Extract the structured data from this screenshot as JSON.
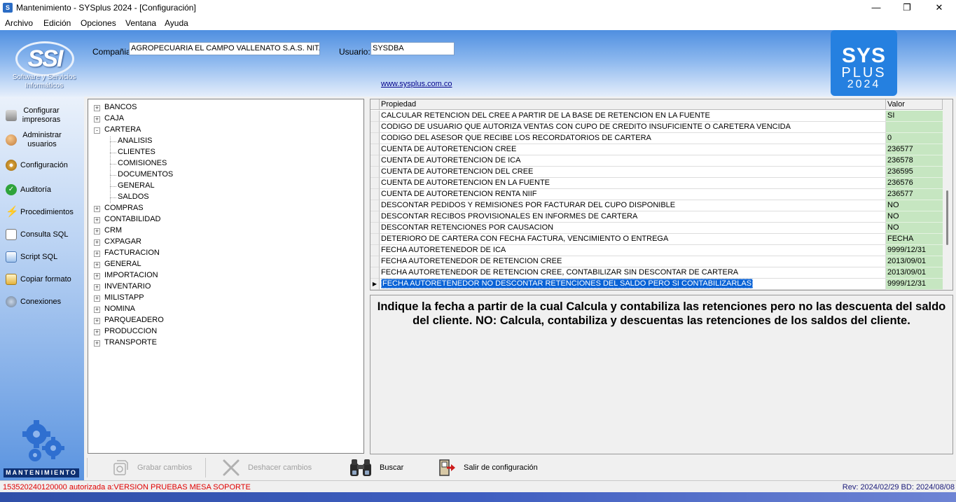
{
  "window": {
    "title": "Mantenimiento - SYSplus 2024 - [Configuración]",
    "app_icon": "S"
  },
  "menu": [
    "Archivo",
    "Edición",
    "Opciones",
    "Ventana",
    "Ayuda"
  ],
  "header": {
    "logo_text": "SSI",
    "logo_subtitle_1": "Software y Servicios",
    "logo_subtitle_2": "Informáticos",
    "company_label": "Compañia:",
    "company_value": "AGROPECUARIA EL CAMPO VALLENATO S.A.S. NIT.",
    "user_label": "Usuario:",
    "user_value": "SYSDBA",
    "website": "www.sysplus.com.co",
    "brand_line1": "SYS",
    "brand_line2": "PLUS",
    "brand_line3": "2024"
  },
  "nav": [
    {
      "label": "Configurar impresoras",
      "icon": "printer-icon"
    },
    {
      "label": "Administrar usuarios",
      "icon": "users-icon"
    },
    {
      "label": "Configuración",
      "icon": "gear-icon"
    },
    {
      "label": "Auditoría",
      "icon": "check-circle-icon"
    },
    {
      "label": "Procedimientos",
      "icon": "lightning-icon"
    },
    {
      "label": "Consulta SQL",
      "icon": "sql-query-icon"
    },
    {
      "label": "Script SQL",
      "icon": "script-icon"
    },
    {
      "label": "Copiar formato",
      "icon": "copy-format-icon"
    },
    {
      "label": "Conexiones",
      "icon": "connections-icon"
    }
  ],
  "nav_badge": "MANTENIMIENTO",
  "tree": [
    {
      "label": "BANCOS",
      "level": 0,
      "expander": "+"
    },
    {
      "label": "CAJA",
      "level": 0,
      "expander": "+"
    },
    {
      "label": "CARTERA",
      "level": 0,
      "expander": "-"
    },
    {
      "label": "ANALISIS",
      "level": 1
    },
    {
      "label": "CLIENTES",
      "level": 1
    },
    {
      "label": "COMISIONES",
      "level": 1
    },
    {
      "label": "DOCUMENTOS",
      "level": 1
    },
    {
      "label": "GENERAL",
      "level": 1
    },
    {
      "label": "SALDOS",
      "level": 1
    },
    {
      "label": "COMPRAS",
      "level": 0,
      "expander": "+"
    },
    {
      "label": "CONTABILIDAD",
      "level": 0,
      "expander": "+"
    },
    {
      "label": "CRM",
      "level": 0,
      "expander": "+"
    },
    {
      "label": "CXPAGAR",
      "level": 0,
      "expander": "+"
    },
    {
      "label": "FACTURACION",
      "level": 0,
      "expander": "+"
    },
    {
      "label": "GENERAL",
      "level": 0,
      "expander": "+"
    },
    {
      "label": "IMPORTACION",
      "level": 0,
      "expander": "+"
    },
    {
      "label": "INVENTARIO",
      "level": 0,
      "expander": "+"
    },
    {
      "label": "MILISTAPP",
      "level": 0,
      "expander": "+"
    },
    {
      "label": "NOMINA",
      "level": 0,
      "expander": "+"
    },
    {
      "label": "PARQUEADERO",
      "level": 0,
      "expander": "+"
    },
    {
      "label": "PRODUCCION",
      "level": 0,
      "expander": "+"
    },
    {
      "label": "TRANSPORTE",
      "level": 0,
      "expander": "+"
    }
  ],
  "grid": {
    "col_property": "Propiedad",
    "col_value": "Valor",
    "rows": [
      {
        "prop": "CALCULAR RETENCION DEL CREE A PARTIR DE LA BASE DE RETENCION EN LA FUENTE",
        "value": "SI"
      },
      {
        "prop": "CODIGO DE USUARIO QUE AUTORIZA VENTAS CON CUPO DE CREDITO INSUFICIENTE O CARETERA VENCIDA",
        "value": ""
      },
      {
        "prop": "CODIGO DEL ASESOR QUE RECIBE LOS RECORDATORIOS DE CARTERA",
        "value": "0"
      },
      {
        "prop": "CUENTA DE AUTORETENCION CREE",
        "value": "236577"
      },
      {
        "prop": "CUENTA DE AUTORETENCION DE ICA",
        "value": "236578"
      },
      {
        "prop": "CUENTA DE AUTORETENCION DEL CREE",
        "value": "236595"
      },
      {
        "prop": "CUENTA DE AUTORETENCION EN LA FUENTE",
        "value": "236576"
      },
      {
        "prop": "CUENTA DE AUTORETENCION RENTA NIIF",
        "value": "236577"
      },
      {
        "prop": "DESCONTAR PEDIDOS Y REMISIONES POR FACTURAR DEL CUPO DISPONIBLE",
        "value": "NO"
      },
      {
        "prop": "DESCONTAR RECIBOS PROVISIONALES EN INFORMES DE CARTERA",
        "value": "NO"
      },
      {
        "prop": "DESCONTAR RETENCIONES POR CAUSACION",
        "value": "NO"
      },
      {
        "prop": "DETERIORO DE CARTERA CON FECHA FACTURA, VENCIMIENTO O ENTREGA",
        "value": "FECHA"
      },
      {
        "prop": "FECHA AUTORETENEDOR DE ICA",
        "value": "9999/12/31"
      },
      {
        "prop": "FECHA AUTORETENEDOR DE RETENCION CREE",
        "value": "2013/09/01"
      },
      {
        "prop": "FECHA AUTORETENEDOR DE RETENCION CREE, CONTABILIZAR SIN DESCONTAR DE CARTERA",
        "value": "2013/09/01"
      },
      {
        "prop": "FECHA AUTORETENEDOR NO DESCONTAR RETENCIONES DEL SALDO PERO SI CONTABILIZARLAS",
        "value": "9999/12/31",
        "selected": true
      }
    ]
  },
  "description": "Indique la fecha a partir de la cual Calcula y contabiliza las retenciones pero no las descuenta del saldo del cliente. NO: Calcula, contabiliza y descuentas las retenciones de los saldos del cliente.",
  "toolbar": {
    "save": "Grabar cambios",
    "undo": "Deshacer cambios",
    "search": "Buscar",
    "exit": "Salir de configuración"
  },
  "status": {
    "left": "153520240120000 autorizada a:VERSION PRUEBAS MESA SOPORTE",
    "right": "Rev: 2024/02/29 BD: 2024/08/08"
  }
}
